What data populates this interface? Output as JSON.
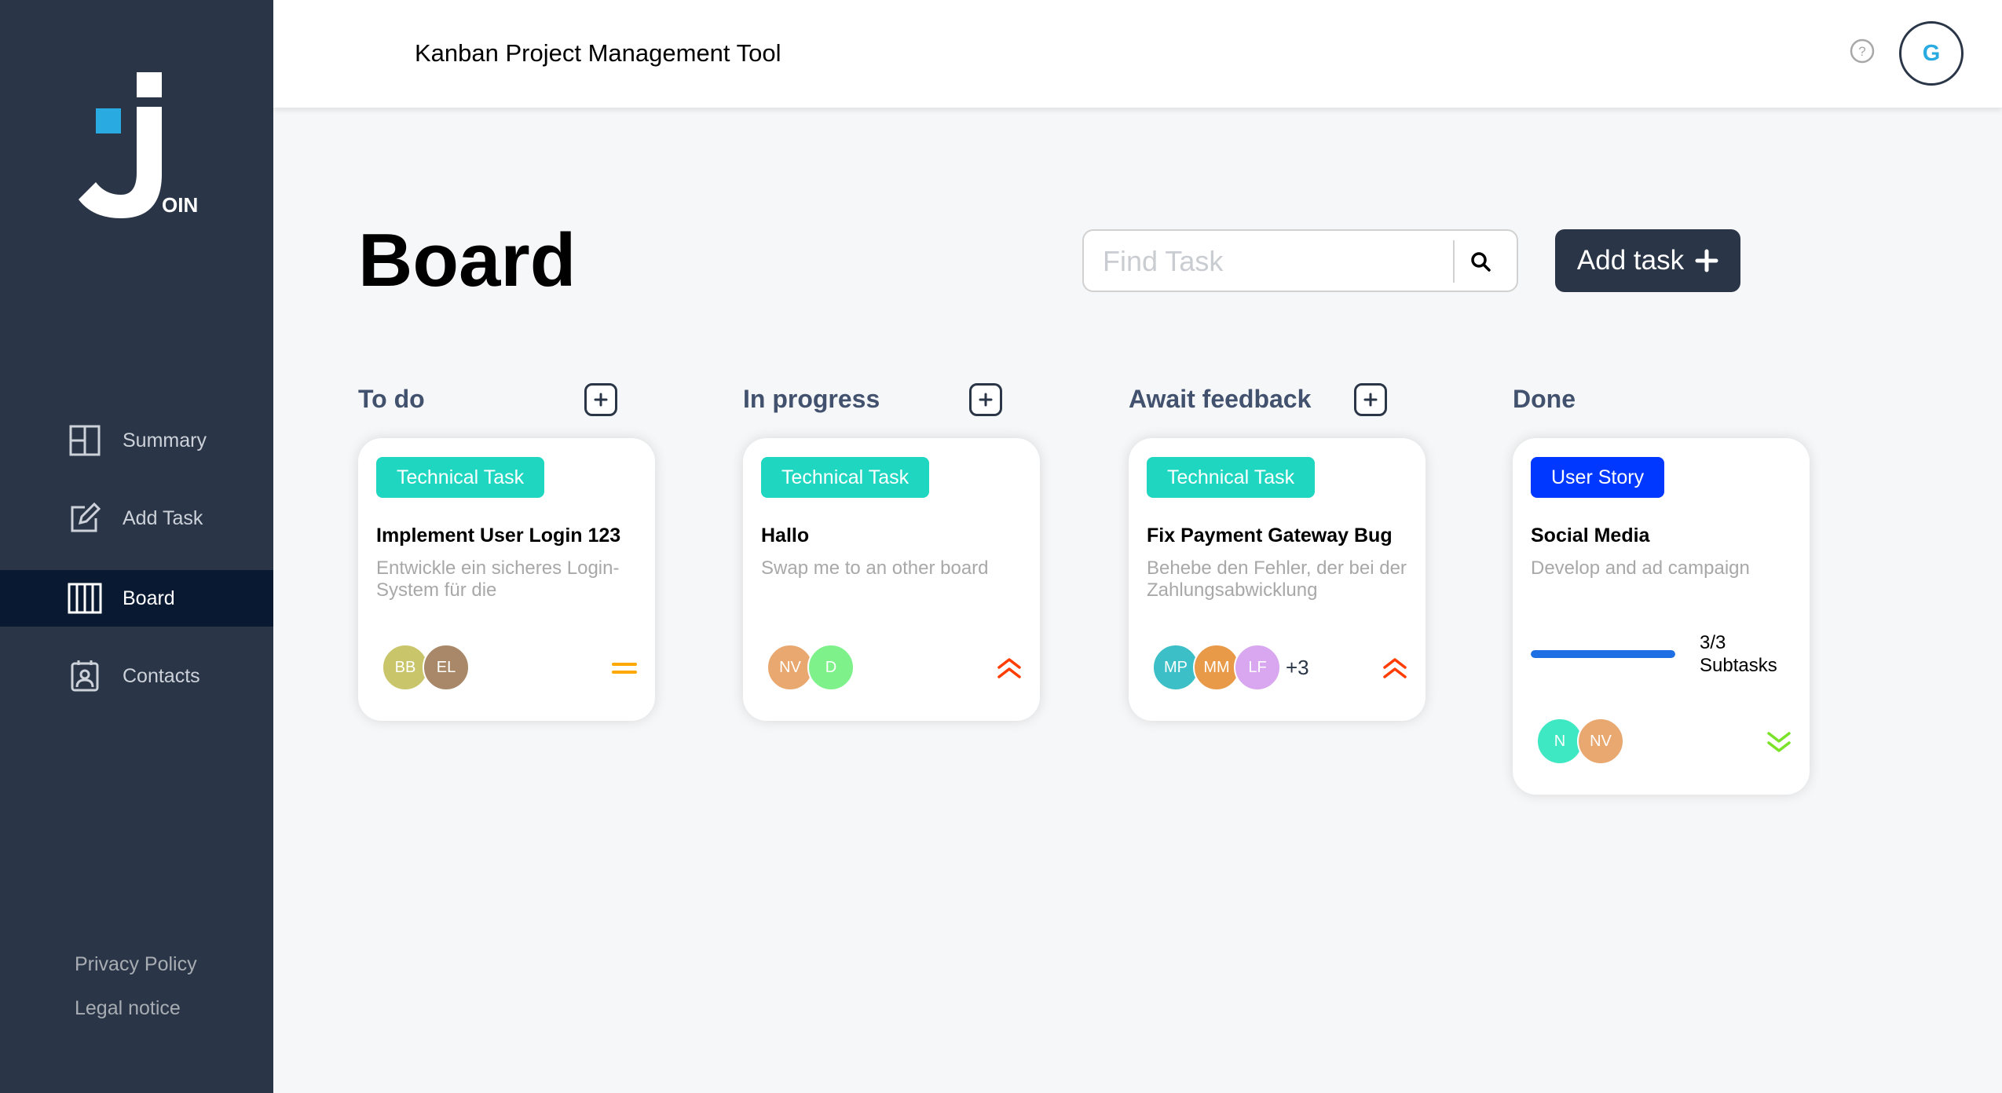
{
  "header": {
    "title": "Kanban Project Management Tool",
    "user_initial": "G"
  },
  "sidebar": {
    "logo_text": "OIN",
    "items": [
      {
        "label": "Summary",
        "icon": "summary-icon"
      },
      {
        "label": "Add Task",
        "icon": "edit-icon"
      },
      {
        "label": "Board",
        "icon": "board-icon",
        "active": true
      },
      {
        "label": "Contacts",
        "icon": "contacts-icon"
      }
    ],
    "footer": {
      "privacy": "Privacy Policy",
      "legal": "Legal notice"
    }
  },
  "board": {
    "title": "Board",
    "search_placeholder": "Find Task",
    "add_task_label": "Add task"
  },
  "columns": [
    {
      "title": "To do"
    },
    {
      "title": "In progress"
    },
    {
      "title": "Await feedback"
    },
    {
      "title": "Done"
    }
  ],
  "cards": [
    {
      "category": "Technical Task",
      "category_color": "#1fd7c1",
      "title": "Implement User Login 123",
      "description": "Entwickle ein sicheres Login-System für die",
      "avatars": [
        {
          "initials": "BB",
          "color": "#c9c56a"
        },
        {
          "initials": "EL",
          "color": "#a88868"
        }
      ],
      "priority": "medium"
    },
    {
      "category": "Technical Task",
      "category_color": "#1fd7c1",
      "title": "Hallo",
      "description": "Swap me to an other board",
      "avatars": [
        {
          "initials": "NV",
          "color": "#e8a870"
        },
        {
          "initials": "D",
          "color": "#7ef18a"
        }
      ],
      "priority": "urgent"
    },
    {
      "category": "Technical Task",
      "category_color": "#1fd7c1",
      "title": "Fix Payment Gateway Bug",
      "description": "Behebe den Fehler, der bei der Zahlungsabwicklung",
      "avatars": [
        {
          "initials": "MP",
          "color": "#3cbfc7"
        },
        {
          "initials": "MM",
          "color": "#e89a48"
        },
        {
          "initials": "LF",
          "color": "#d9a6f0"
        }
      ],
      "more": "+3",
      "priority": "urgent"
    },
    {
      "category": "User Story",
      "category_color": "#0038ff",
      "title": "Social Media",
      "description": "Develop and ad campaign",
      "subtasks_done": 3,
      "subtasks_total": 3,
      "subtasks_count": "3/3",
      "subtasks_label": "Subtasks",
      "avatars": [
        {
          "initials": "N",
          "color": "#3ee8c2"
        },
        {
          "initials": "NV",
          "color": "#e8a870"
        }
      ],
      "priority": "low"
    }
  ],
  "colors": {
    "sidebar": "#2a3647",
    "active_nav": "#091931",
    "urgent": "#ff3d00",
    "medium": "#ffa800",
    "low": "#7ae229"
  }
}
